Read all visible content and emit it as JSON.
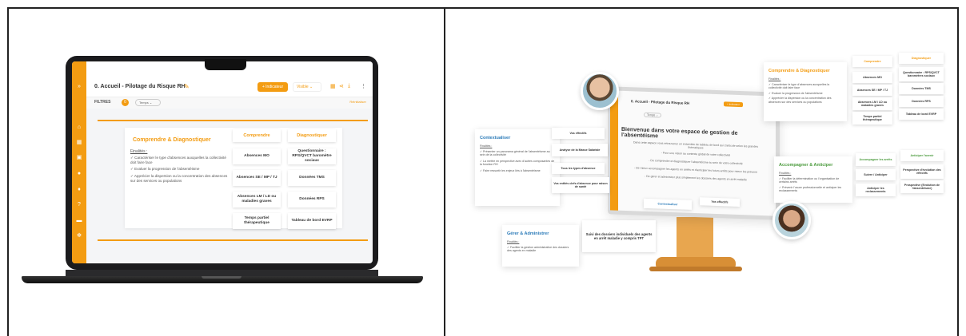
{
  "laptop": {
    "page_title": "0. Accueil - Pilotage du Risque RH",
    "indicator_button": "+ Indicateur",
    "visibility_select": "Visible ⌄",
    "filters_label": "FILTRES",
    "filters_count": "0",
    "filter_chip": "Temps ⌄",
    "filter_action": "Réinitialiser",
    "card": {
      "heading": "Comprendre & Diagnostiquer",
      "finalites": "Finalités :",
      "bullets": [
        "✓ Caractériser le type d'absences auxquelles la collectivité doit faire face",
        "✓ Evaluer la progression de l'absentéisme",
        "✓ Apprécier la dispersion ou la concentration des absences sur des services ou populations"
      ],
      "col1_header": "Comprendre",
      "col2_header": "Diagnostiquer",
      "col1": [
        "Absences MO",
        "Absences SE / MP / TJ",
        "Absences LM / LD ou maladies graves",
        "Temps partiel thérapeutique"
      ],
      "col2": [
        "Questionnaire : RPS/QVCT baromètre sociaux",
        "Données TMS",
        "Données RPS",
        "Tableau de bord EVRP"
      ]
    },
    "icons": [
      "chevron-right-icon",
      "home-icon",
      "dashboard-icon",
      "calendar-icon",
      "users-icon",
      "bell-icon",
      "help-icon",
      "chat-icon",
      "settings-icon"
    ]
  },
  "montage": {
    "monitor_title": "0. Accueil - Pilotage du Risque RH",
    "monitor_button": "+ Indicateur",
    "monitor_chip": "Temps ⌄",
    "welcome": "Bienvenue dans votre espace de gestion de l'absentéisme",
    "lines": [
      "Dans cette espace vous retrouverez un ensemble de tableau de bord qui s'articule selon les grandes thématiques",
      "- Pour une vision au contexte global de votre collectivité",
      "- De comprendre et diagnostiquer l'absentéisme au sein de votre collectivité",
      "- De mieux accompagner les agents en arrêts et d'anticiper les futurs arrêts pour mieux les prévenir",
      "- De gérer et administrer plus simplement les dossiers des agents en arrêt maladie"
    ],
    "contextualiser": {
      "heading": "Contextualiser",
      "finalites": "Finalités :",
      "bullets": [
        "✓ Présenter un panorama général de l'absentéisme au sein de la collectivité",
        "✓ La mettre en perspective avec d'autres composantes de la fonction RH",
        "✓ Faire ressortir les enjeux liés à l'absentéisme"
      ],
      "items": [
        "Vos effectifs",
        "Analyse de la Masse Salariale",
        "Tous les types d'absence",
        "Vos entités clefs d'absence pour raison de santé"
      ]
    },
    "comprendre": {
      "heading": "Comprendre & Diagnostiquer",
      "finalites": "Finalités :",
      "bullets": [
        "✓ Caractériser le type d'absences auxquelles la collectivité doit faire face",
        "✓ Evaluer la progression de l'absentéisme",
        "✓ Apprécier la dispersion ou la concentration des absences sur des services ou populations"
      ],
      "col1_header": "Comprendre",
      "col2_header": "Diagnostiquer",
      "col1": [
        "Absences MO",
        "Absences SE / MP / TJ",
        "Absences LM / LD ou maladies graves",
        "Temps partiel thérapeutique"
      ],
      "col2": [
        "Questionnaire : RPS/QVCT baromètres sociaux",
        "Données TMS",
        "Données RPS",
        "Tableau de bord EVRP"
      ]
    },
    "accompagner": {
      "heading": "Accompagner & Anticiper",
      "finalites": "Finalités :",
      "bullets": [
        "✓ Faciliter la détermination ou l'organisation de certains arrêts",
        "✓ Prévenir l'usure professionnelle et anticiper les reclassements"
      ],
      "col1_header": "Accompagner les arrêts",
      "col2_header": "Anticiper l'avenir",
      "col1": [
        "Suivre / Anticiper",
        "Anticiper les reclassements"
      ],
      "col2": [
        "Perspective d'évolution des effectifs",
        "Prospective (Evolution de l'absentéisme)"
      ]
    },
    "gerer": {
      "heading": "Gérer & Administrer",
      "finalites": "Finalités :",
      "bullets": [
        "✓ Faciliter la gestion administrative des dossiers des agents en maladie"
      ],
      "item": "Suivi des dossiers individuels des agents en arrêt maladie y compris TPT"
    },
    "bottom_tabs": [
      "Contextualiser",
      "Vos effectifs"
    ]
  }
}
